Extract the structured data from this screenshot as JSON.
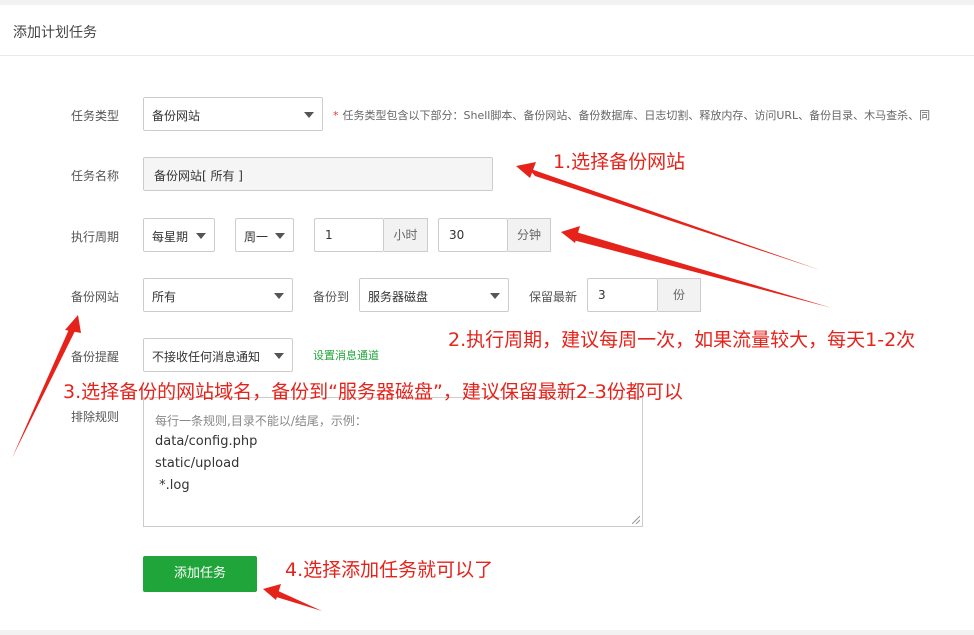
{
  "panel": {
    "title": "添加计划任务"
  },
  "form": {
    "task_type": {
      "label": "任务类型",
      "value": "备份网站",
      "hint": "任务类型包含以下部分：Shell脚本、备份网站、备份数据库、日志切割、释放内存、访问URL、备份目录、木马查杀、同"
    },
    "task_name": {
      "label": "任务名称",
      "value": "备份网站[ 所有 ]"
    },
    "cycle": {
      "label": "执行周期",
      "period": "每星期",
      "weekday": "周一",
      "hour": "1",
      "hour_unit": "小时",
      "minute": "30",
      "minute_unit": "分钟"
    },
    "backup_site": {
      "label": "备份网站",
      "value": "所有",
      "backup_to_label": "备份到",
      "backup_to_value": "服务器磁盘",
      "keep_label": "保留最新",
      "keep_value": "3",
      "keep_unit": "份"
    },
    "notify": {
      "label": "备份提醒",
      "value": "不接收任何消息通知",
      "link": "设置消息通道"
    },
    "exclude": {
      "label": "排除规则",
      "placeholder": "每行一条规则,目录不能以/结尾，示例：",
      "lines": [
        "data/config.php",
        "static/upload",
        " *.log"
      ]
    },
    "submit_label": "添加任务"
  },
  "annotations": {
    "a1": "1.选择备份网站",
    "a2": "2.执行周期，建议每周一次，如果流量较大，每天1-2次",
    "a3": "3.选择备份的网站域名，备份到“服务器磁盘”，建议保留最新2-3份都可以",
    "a4": "4.选择添加任务就可以了"
  },
  "colors": {
    "accent_green": "#20a53a",
    "annotation_red": "#e5231b",
    "required_red": "#e53935"
  },
  "icons": [
    "chevron-down-icon",
    "resize-grip-icon",
    "arrow-annotation"
  ]
}
